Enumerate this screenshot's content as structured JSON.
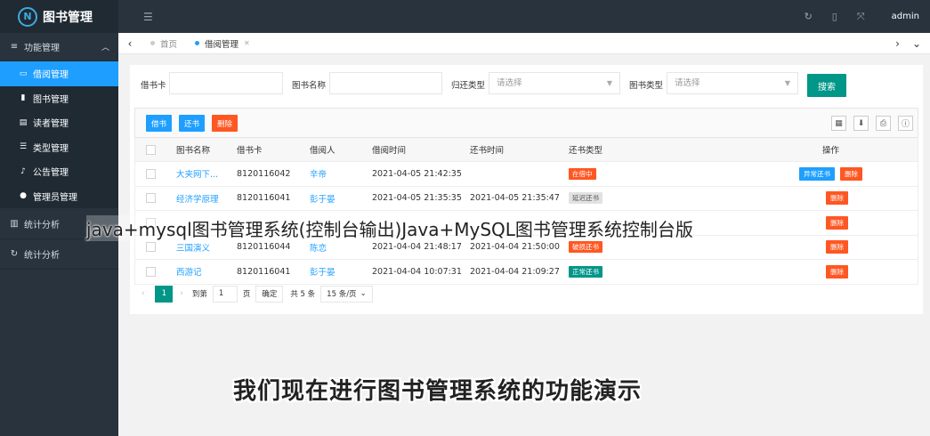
{
  "app": {
    "title": "图书管理",
    "logo_letter": "N",
    "admin": "admin"
  },
  "sidebar": {
    "group1": "功能管理",
    "items": [
      {
        "label": "借阅管理",
        "icon": "window-icon"
      },
      {
        "label": "图书管理",
        "icon": "book-icon"
      },
      {
        "label": "读者管理",
        "icon": "card-icon"
      },
      {
        "label": "类型管理",
        "icon": "list-icon"
      },
      {
        "label": "公告管理",
        "icon": "bell-icon"
      },
      {
        "label": "管理员管理",
        "icon": "user-icon"
      }
    ],
    "group2": "统计分析",
    "group3": "统计分析"
  },
  "tabs": [
    {
      "label": "首页"
    },
    {
      "label": "借阅管理"
    }
  ],
  "search": {
    "card_label": "借书卡",
    "name_label": "图书名称",
    "status_label": "归还类型",
    "status_placeholder": "请选择",
    "type_label": "图书类型",
    "type_placeholder": "请选择",
    "button": "搜索"
  },
  "toolbar": {
    "borrow": "借书",
    "return": "还书",
    "delete": "删除"
  },
  "table": {
    "headers": [
      "图书名称",
      "借书卡",
      "借阅人",
      "借阅时间",
      "还书时间",
      "还书类型",
      "操作"
    ],
    "rows": [
      {
        "name": "大夹网下...",
        "card": "8120116042",
        "reader": "辛帝",
        "borrow_time": "2021-04-05 21:42:35",
        "return_time": "",
        "status": "在借中",
        "status_color": "#ff5722",
        "ops": [
          "异常还书",
          "删除"
        ]
      },
      {
        "name": "经济学原理",
        "card": "8120116041",
        "reader": "彭于晏",
        "borrow_time": "2021-04-05 21:35:35",
        "return_time": "2021-04-05 21:35:47",
        "status": "延迟还书",
        "status_color": "#cccccc",
        "ops": [
          "删除"
        ]
      },
      {
        "name": "",
        "card": "",
        "reader": "",
        "borrow_time": "",
        "return_time": "",
        "status": "",
        "status_color": "",
        "ops": []
      },
      {
        "name": "三国演义",
        "card": "8120116044",
        "reader": "陈恋",
        "borrow_time": "2021-04-04 21:48:17",
        "return_time": "2021-04-04 21:50:00",
        "status": "破损还书",
        "status_color": "#ff5722",
        "ops": [
          "删除"
        ]
      },
      {
        "name": "西游记",
        "card": "8120116041",
        "reader": "彭于晏",
        "borrow_time": "2021-04-04 10:07:31",
        "return_time": "2021-04-04 21:09:27",
        "status": "正常还书",
        "status_color": "#009688",
        "ops": [
          "删除"
        ]
      }
    ]
  },
  "pager": {
    "current": "1",
    "goto": "到第",
    "page_input": "1",
    "page_unit": "页",
    "confirm": "确定",
    "total": "共 5 条",
    "per_page": "15 条/页"
  },
  "overlay": {
    "watermark": "java+mysql图书管理系统(控制台输出)Java+MySQL图书管理系统控制台版",
    "subtitle": "我们现在进行图书管理系统的功能演示"
  },
  "colors": {
    "sidebar": "#28333e",
    "active": "#1e9fff",
    "primary": "#009688",
    "danger": "#ff5722"
  }
}
